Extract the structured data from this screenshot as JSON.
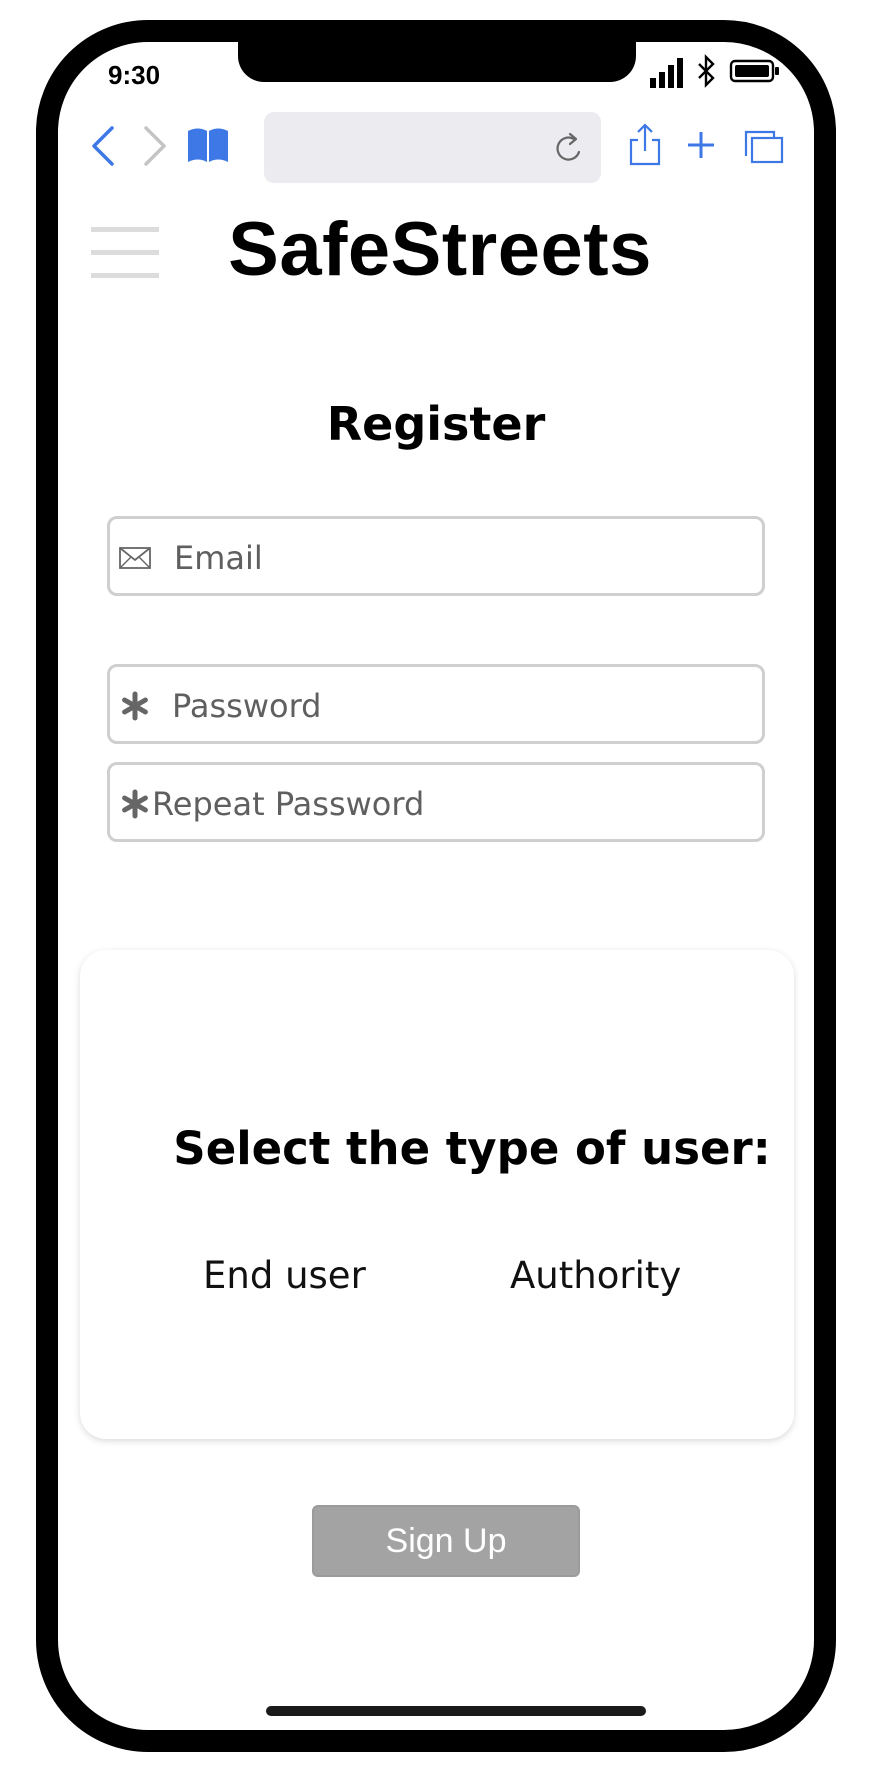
{
  "status_bar": {
    "time": "9:30"
  },
  "browser": {
    "back_icon": "chevron-left-icon",
    "forward_icon": "chevron-right-icon",
    "bookmarks_icon": "book-icon",
    "reload_icon": "reload-icon",
    "share_icon": "share-icon",
    "new_tab_icon": "plus-icon",
    "tabs_icon": "tabs-icon",
    "accent_color": "#3d78e6"
  },
  "header": {
    "menu_icon": "hamburger-icon",
    "app_title": "SafeStreets"
  },
  "form": {
    "title": "Register",
    "email_placeholder": "Email",
    "password_placeholder": "Password",
    "repeat_password_placeholder": "Repeat Password"
  },
  "user_type": {
    "title": "Select the type of user:",
    "options": [
      "End user",
      "Authority"
    ]
  },
  "signup": {
    "label": "Sign Up",
    "color": "#a3a3a3"
  }
}
